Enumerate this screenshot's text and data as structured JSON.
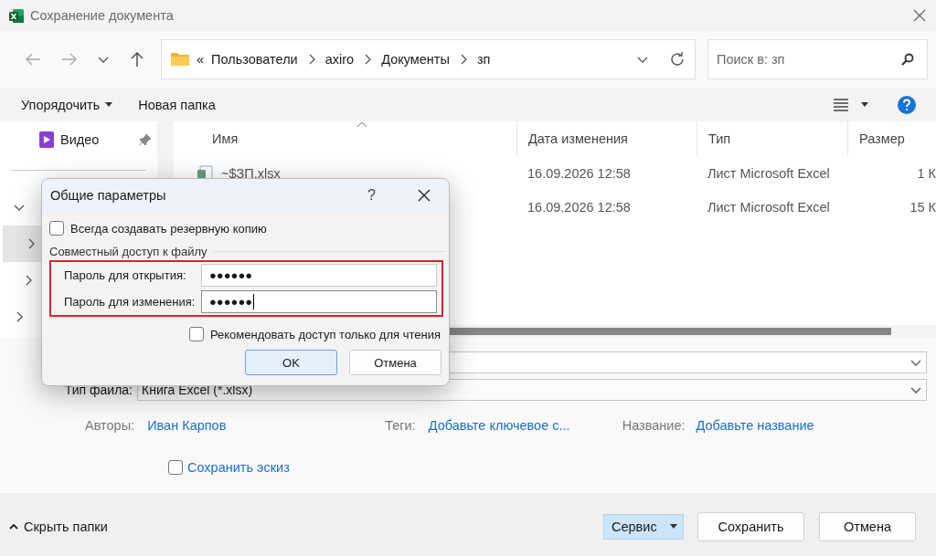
{
  "window": {
    "title": "Сохранение документа"
  },
  "address": {
    "overflow": "«",
    "crumbs": [
      "Пользователи",
      "axiro",
      "Документы",
      "зп"
    ]
  },
  "search": {
    "placeholder": "Поиск в: зп"
  },
  "toolbar": {
    "organize": "Упорядочить",
    "new_folder": "Новая папка"
  },
  "sidebar": {
    "items": [
      {
        "label": "Видео",
        "pinned": true
      }
    ],
    "tree": [
      {
        "expanded": true,
        "selected": false
      },
      {
        "expanded": false,
        "selected": true
      },
      {
        "expanded": false,
        "selected": false
      },
      {
        "expanded": false,
        "selected": false
      }
    ]
  },
  "table": {
    "columns": [
      "Имя",
      "Дата изменения",
      "Тип",
      "Размер"
    ],
    "rows": [
      {
        "name": "~$ЗП.xlsx",
        "date": "16.09.2026 12:58",
        "type": "Лист Microsoft Excel",
        "size": "1 К"
      },
      {
        "date": "16.09.2026 12:58",
        "type": "Лист Microsoft Excel",
        "size": "15 К"
      }
    ]
  },
  "form": {
    "file_type_label": "Тип файла:",
    "file_type": "Книга Excel (*.xlsx)",
    "meta": [
      {
        "label": "Авторы:",
        "value": "Иван Карпов"
      },
      {
        "label": "Теги:",
        "value": "Добавьте ключевое с..."
      },
      {
        "label": "Название:",
        "value": "Добавьте название"
      }
    ],
    "thumbnail": {
      "label": "Сохранить эскиз",
      "checked": false
    }
  },
  "footer": {
    "hide_folders": "Скрыть папки",
    "tools": "Сервис",
    "save": "Сохранить",
    "cancel": "Отмена"
  },
  "modal": {
    "title": "Общие параметры",
    "help": "?",
    "backup": {
      "label": "Всегда создавать резервную копию",
      "checked": false
    },
    "section": "Совместный доступ к файлу",
    "fields": [
      {
        "label": "Пароль для открытия:",
        "value": "●●●●●●",
        "focused": false
      },
      {
        "label": "Пароль для изменения:",
        "value": "●●●●●●",
        "focused": true
      }
    ],
    "readonly": {
      "label": "Рекомендовать доступ только для чтения",
      "checked": false
    },
    "ok": "OK",
    "cancel": "Отмена"
  }
}
